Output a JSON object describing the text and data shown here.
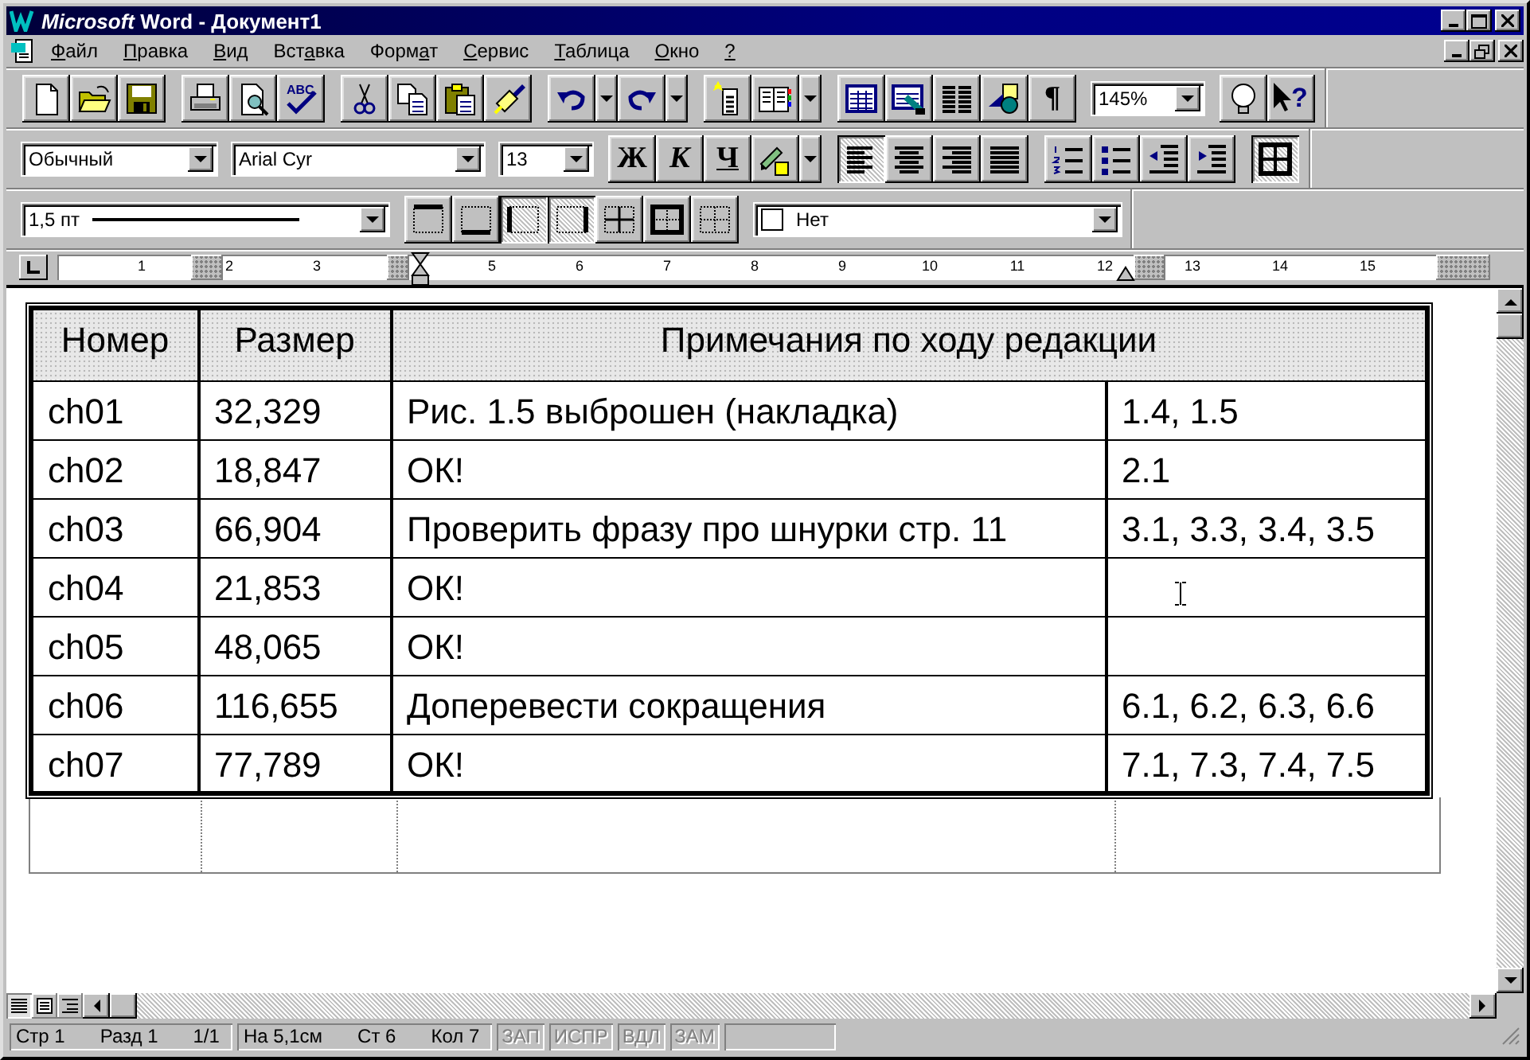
{
  "window": {
    "brand": "Microsoft",
    "title": "Word - Документ1"
  },
  "menu": [
    {
      "label": "Файл"
    },
    {
      "label": "Правка"
    },
    {
      "label": "Вид"
    },
    {
      "label": "Вставка"
    },
    {
      "label": "Формат"
    },
    {
      "label": "Сервис"
    },
    {
      "label": "Таблица"
    },
    {
      "label": "Окно"
    },
    {
      "label": "?"
    }
  ],
  "standard_toolbar": {
    "spell_label": "ABC",
    "pilcrow": "¶",
    "help_mark": "?",
    "zoom": "145%"
  },
  "formatting_toolbar": {
    "style": "Обычный",
    "font": "Arial Cyr",
    "size": "13",
    "bold": "Ж",
    "italic": "К",
    "underline": "Ч",
    "align": [
      {
        "selected": true
      },
      {
        "selected": false
      },
      {
        "selected": false
      },
      {
        "selected": false
      }
    ],
    "table_grid": {
      "selected": true
    }
  },
  "borders_toolbar": {
    "line_weight": "1,5 пт",
    "shading": "Нет",
    "borders": [
      {
        "selected": false
      },
      {
        "selected": false
      },
      {
        "selected": true
      },
      {
        "selected": true
      },
      {
        "selected": false
      },
      {
        "selected": false
      },
      {
        "selected": false
      }
    ]
  },
  "ruler": {
    "numbers": [
      "1",
      "2",
      "3",
      "5",
      "6",
      "7",
      "8",
      "9",
      "10",
      "11",
      "12",
      "13",
      "14",
      "15"
    ]
  },
  "table": {
    "header": [
      "Номер",
      "Размер",
      "Примечания по ходу редакции"
    ],
    "rows": [
      [
        "ch01",
        "32,329",
        "Рис. 1.5 выброшен (накладка)",
        "1.4, 1.5"
      ],
      [
        "ch02",
        "18,847",
        "ОК!",
        "2.1"
      ],
      [
        "ch03",
        "66,904",
        "Проверить фразу про шнурки стр. 11",
        "3.1, 3.3, 3.4, 3.5"
      ],
      [
        "ch04",
        "21,853",
        "ОК!",
        ""
      ],
      [
        "ch05",
        "48,065",
        "ОК!",
        ""
      ],
      [
        "ch06",
        "116,655",
        "Доперевести сокращения",
        "6.1, 6.2, 6.3, 6.6"
      ],
      [
        "ch07",
        "77,789",
        "ОК!",
        "7.1, 7.3, 7.4, 7.5"
      ]
    ]
  },
  "status_bar": {
    "groups": [
      [
        "Стр 1",
        "Разд 1",
        "1/1"
      ],
      [
        "На 5,1см",
        "Ст 6",
        "Кол 7"
      ]
    ],
    "indicators": [
      {
        "label": "ЗАП",
        "disabled": true
      },
      {
        "label": "ИСПР",
        "disabled": true
      },
      {
        "label": "ВДЛ",
        "disabled": true
      },
      {
        "label": "ЗАМ",
        "disabled": true
      }
    ]
  }
}
